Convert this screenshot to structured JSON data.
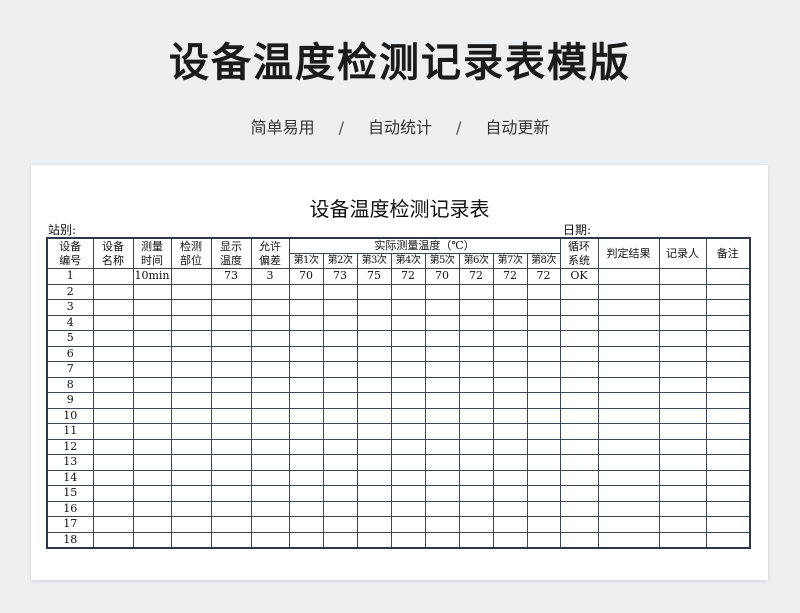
{
  "banner": {
    "title": "设备温度检测记录表模版",
    "tags": [
      "简单易用",
      "自动统计",
      "自动更新"
    ],
    "separator": "/"
  },
  "sheet": {
    "title": "设备温度检测记录表",
    "station_label": "站别:",
    "date_label": "日期:",
    "headers": {
      "device_no": [
        "设备",
        "编号"
      ],
      "device_name": [
        "设备",
        "名称"
      ],
      "measure_time": [
        "测量",
        "时间"
      ],
      "inspect_part": [
        "检测",
        "部位"
      ],
      "display_temp": [
        "显示",
        "温度"
      ],
      "tolerance": [
        "允许",
        "偏差"
      ],
      "actual_group": "实际测量温度（℃）",
      "readings": [
        "第1次",
        "第2次",
        "第3次",
        "第4次",
        "第5次",
        "第6次",
        "第7次",
        "第8次"
      ],
      "circulation": [
        "循环",
        "系统"
      ],
      "judgement": "判定结果",
      "recorder": "记录人",
      "remarks": "备注"
    },
    "rows": [
      {
        "no": "1",
        "name": "",
        "time": "10min",
        "part": "",
        "display": "73",
        "tol": "3",
        "readings": [
          "70",
          "73",
          "75",
          "72",
          "70",
          "72",
          "72",
          "72"
        ],
        "circ": "OK",
        "result": "",
        "recorder": "",
        "remark": ""
      },
      {
        "no": "2"
      },
      {
        "no": "3"
      },
      {
        "no": "4"
      },
      {
        "no": "5"
      },
      {
        "no": "6"
      },
      {
        "no": "7"
      },
      {
        "no": "8"
      },
      {
        "no": "9"
      },
      {
        "no": "10"
      },
      {
        "no": "11"
      },
      {
        "no": "12"
      },
      {
        "no": "13"
      },
      {
        "no": "14"
      },
      {
        "no": "15"
      },
      {
        "no": "16"
      },
      {
        "no": "17"
      },
      {
        "no": "18"
      }
    ]
  }
}
